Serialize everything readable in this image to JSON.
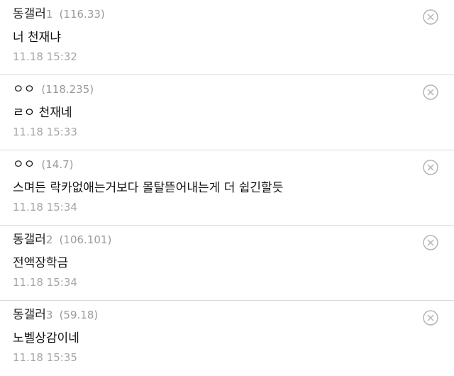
{
  "comments": [
    {
      "nick": "동갤러",
      "nick_num": "1",
      "ip": "(116.33)",
      "text": "너 천재냐",
      "time": "11.18 15:32"
    },
    {
      "nick": "ㅇㅇ",
      "nick_num": "",
      "ip": "(118.235)",
      "text": "ㄹㅇ 천재네",
      "time": "11.18 15:33"
    },
    {
      "nick": "ㅇㅇ",
      "nick_num": "",
      "ip": "(14.7)",
      "text": "스며든 락카없애는거보다 몰탈뜯어내는게 더 쉽긴할듯",
      "time": "11.18 15:34"
    },
    {
      "nick": "동갤러",
      "nick_num": "2",
      "ip": "(106.101)",
      "text": "전액장학금",
      "time": "11.18 15:34"
    },
    {
      "nick": "동갤러",
      "nick_num": "3",
      "ip": "(59.18)",
      "text": "노벨상감이네",
      "time": "11.18 15:35"
    }
  ],
  "icons": {
    "delete": "close-circle-icon"
  },
  "colors": {
    "nick": "#222222",
    "ip": "#9a9a9a",
    "text": "#111111",
    "time": "#a5a5a5",
    "divider": "#d9d9d9",
    "icon": "#b5b5b5"
  }
}
